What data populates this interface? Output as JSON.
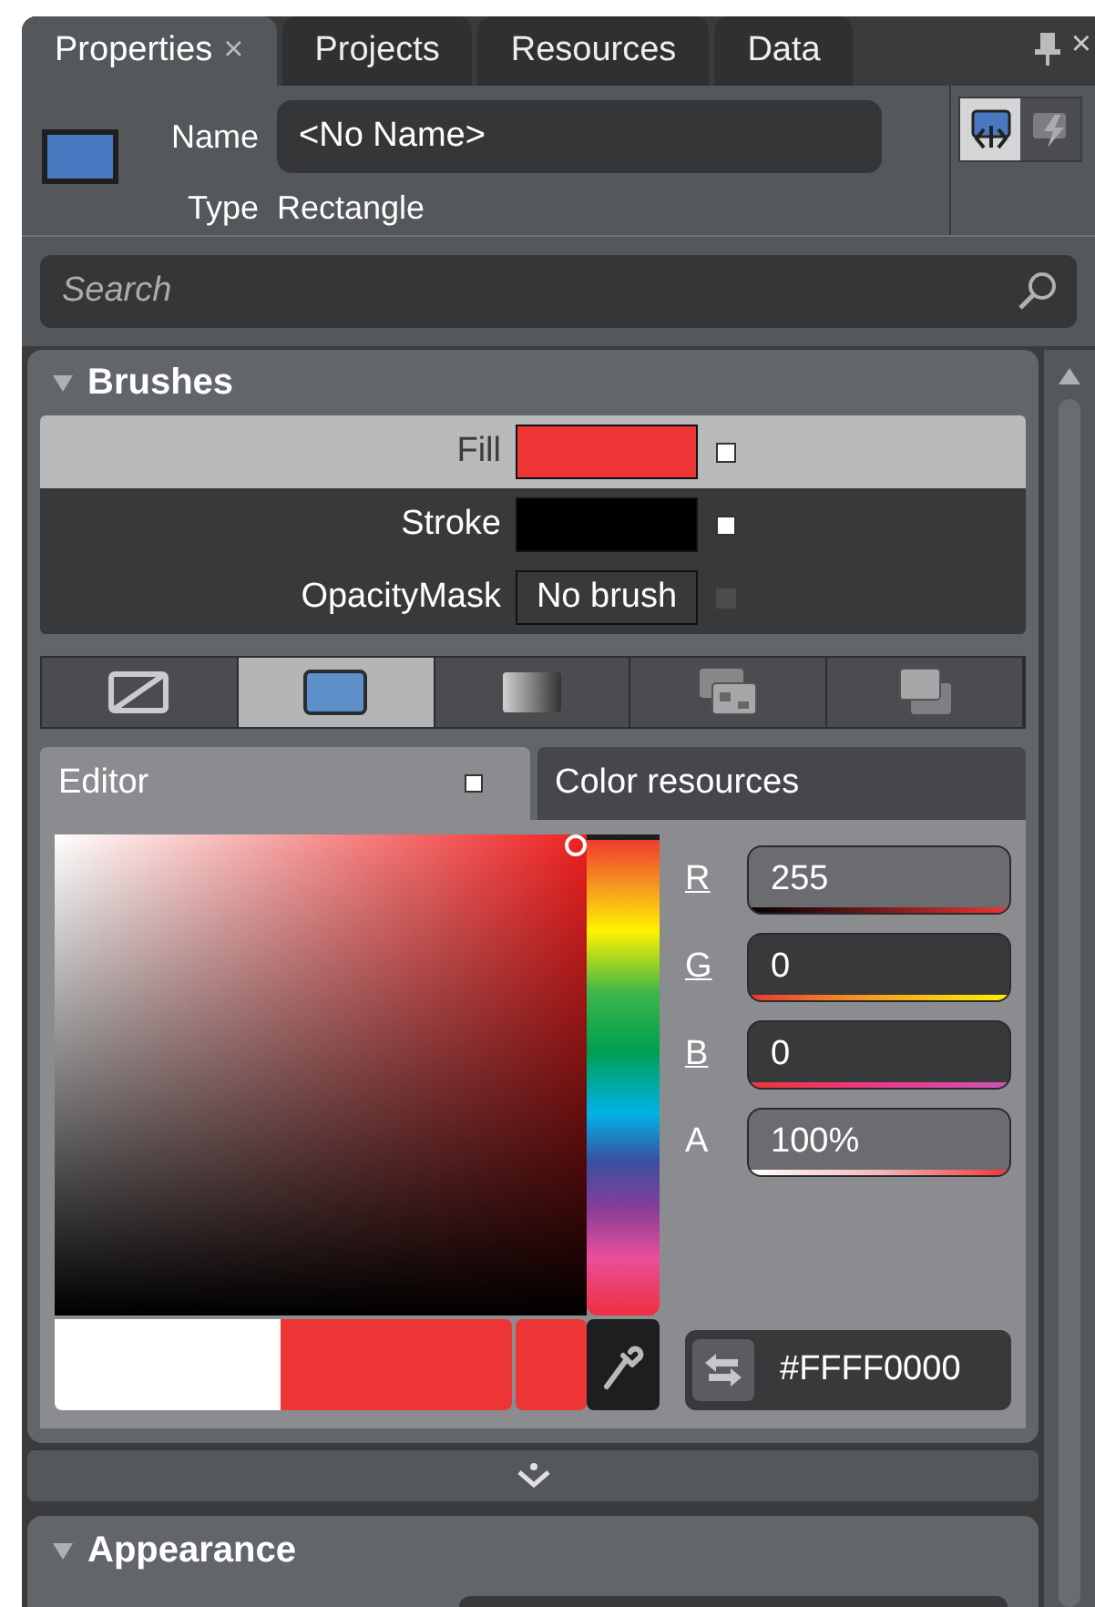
{
  "tabs": [
    {
      "label": "Properties",
      "selected": true,
      "close": "×"
    },
    {
      "label": "Projects",
      "selected": false
    },
    {
      "label": "Resources",
      "selected": false
    },
    {
      "label": "Data",
      "selected": false
    }
  ],
  "panel_close": "×",
  "element": {
    "name_label": "Name",
    "name_value": "<No Name>",
    "type_label": "Type",
    "type_value": "Rectangle",
    "swatch": {
      "color": "#4a78c0"
    }
  },
  "view_buttons": [
    {
      "kind": "properties",
      "selected": true
    },
    {
      "kind": "events",
      "selected": false
    }
  ],
  "search": {
    "placeholder": "Search"
  },
  "brushes": {
    "title": "Brushes",
    "expanded": true,
    "rows": [
      {
        "label": "Fill",
        "selected": true,
        "kind": "swatch",
        "color": "#ee3536",
        "set": true
      },
      {
        "label": "Stroke",
        "selected": false,
        "kind": "swatch",
        "color": "#000000",
        "set": true
      },
      {
        "label": "OpacityMask",
        "selected": false,
        "kind": "text",
        "value": "No brush",
        "set": false
      }
    ]
  },
  "brush_types": [
    {
      "kind": "none",
      "selected": false
    },
    {
      "kind": "solid",
      "selected": true
    },
    {
      "kind": "gradient",
      "selected": false
    },
    {
      "kind": "tile",
      "selected": false
    },
    {
      "kind": "resource",
      "selected": false
    }
  ],
  "editor_tabs": [
    {
      "label": "Editor",
      "selected": true,
      "marker": true
    },
    {
      "label": "Color resources",
      "selected": false,
      "marker": false
    }
  ],
  "channels": [
    {
      "label": "R",
      "underlined": true,
      "value": "255",
      "kind": "red"
    },
    {
      "label": "G",
      "underlined": true,
      "value": "0",
      "kind": "green"
    },
    {
      "label": "B",
      "underlined": true,
      "value": "0",
      "kind": "blue"
    },
    {
      "label": "A",
      "underlined": false,
      "value": "100%",
      "kind": "alpha"
    }
  ],
  "hue": {
    "level": 0
  },
  "swatches": [
    {
      "kind": "initial",
      "color": "#ffffff"
    },
    {
      "kind": "current",
      "color": "#ee3536"
    },
    {
      "kind": "last",
      "color": "#ee3536"
    }
  ],
  "hex": "#FFFF0000",
  "appearance": {
    "title": "Appearance",
    "expanded": true
  }
}
